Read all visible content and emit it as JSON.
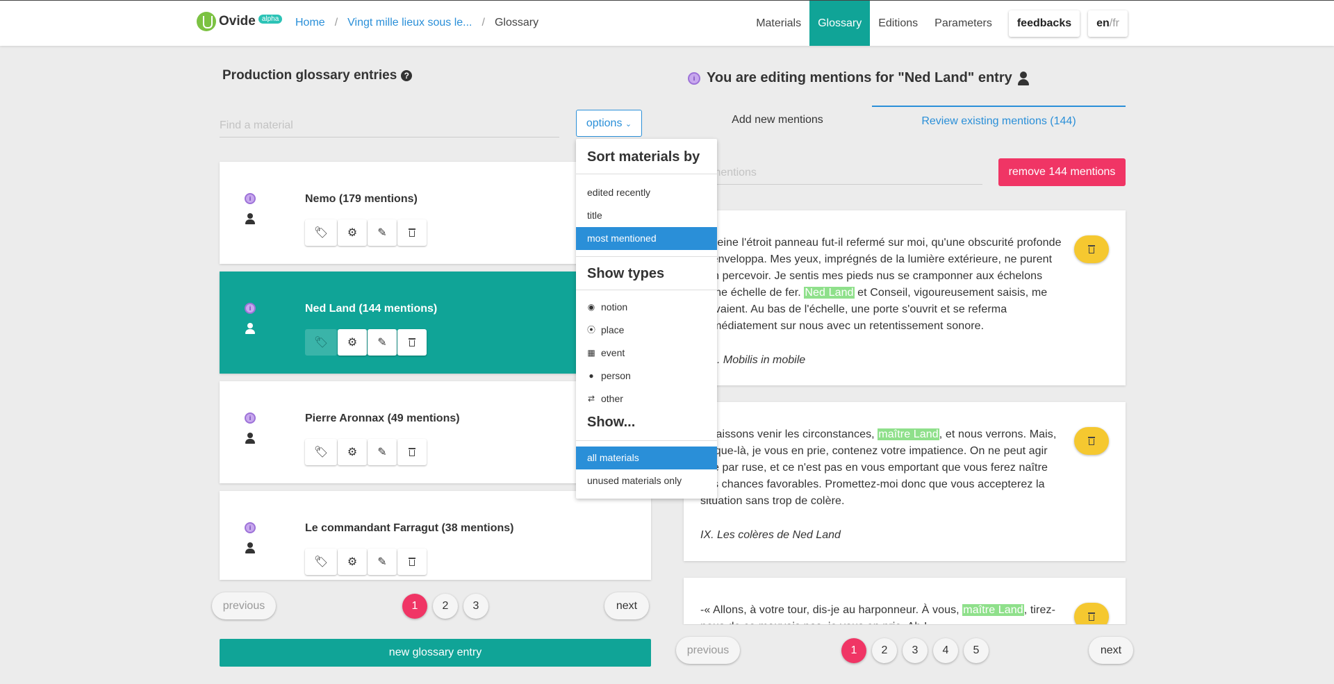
{
  "header": {
    "logo_text": "Ovide",
    "logo_badge": "alpha",
    "breadcrumb": [
      "Home",
      "Vingt mille lieux sous le...",
      "Glossary"
    ],
    "nav": [
      "Materials",
      "Glossary",
      "Editions",
      "Parameters"
    ],
    "active_nav": "Glossary",
    "feedbacks": "feedbacks",
    "lang_en": "en",
    "lang_fr": "/fr"
  },
  "left": {
    "title": "Production glossary entries",
    "search_placeholder": "Find a material",
    "options_label": "options",
    "entries": [
      {
        "name": "Nemo (179 mentions)",
        "selected": false
      },
      {
        "name": "Ned Land (144 mentions)",
        "selected": true
      },
      {
        "name": "Pierre Aronnax (49 mentions)",
        "selected": false
      },
      {
        "name": "Le commandant Farragut (38 mentions)",
        "selected": false
      }
    ],
    "pager": {
      "previous": "previous",
      "next": "next",
      "pages": [
        "1",
        "2",
        "3"
      ],
      "current": "1"
    },
    "new_entry": "new glossary entry"
  },
  "dropdown": {
    "sort_heading": "Sort materials by",
    "sort_options": [
      "edited recently",
      "title",
      "most mentioned"
    ],
    "sort_active": "most mentioned",
    "types_heading": "Show types",
    "types": [
      "notion",
      "place",
      "event",
      "person",
      "other"
    ],
    "show_heading": "Show...",
    "show_options": [
      "all materials",
      "unused materials only"
    ],
    "show_active": "all materials"
  },
  "right": {
    "title": "You are editing mentions for \"Ned Land\" entry",
    "tab_add": "Add new mentions",
    "tab_review": "Review existing mentions (144)",
    "filter_placeholder": "Filter mentions",
    "remove_label": "remove 144 mentions",
    "mentions": [
      {
        "before": "À peine l'étroit panneau fut-il refermé sur moi, qu'une obscurité profonde m'enveloppa. Mes yeux, imprégnés de la lumière extérieure, ne purent rien percevoir. Je sentis mes pieds nus se cramponner aux échelons d'une échelle de fer. ",
        "highlight": "Ned Land",
        "after": " et Conseil, vigoureusement saisis, me suivaient. Au bas de l'échelle, une porte s'ouvrit et se referma immédiatement sur nous avec un retentissement sonore.",
        "source": "VIII. Mobilis in mobile"
      },
      {
        "before": "– Laissons venir les circonstances, ",
        "highlight": "maître Land",
        "after": ", et nous verrons. Mais, jusque-là, je vous en prie, contenez votre impatience. On ne peut agir que par ruse, et ce n'est pas en vous emportant que vous ferez naître des chances favorables. Promettez-moi donc que vous accepterez la situation sans trop de colère.",
        "source": "IX. Les colères de Ned Land"
      },
      {
        "before": "-« Allons, à votre tour, dis-je au harponneur. À vous, ",
        "highlight": "maître Land",
        "after": ", tirez-nous de ce mauvais pas, je vous en prie. Ah !",
        "source": ""
      }
    ],
    "pager": {
      "previous": "previous",
      "next": "next",
      "pages": [
        "1",
        "2",
        "3",
        "4",
        "5"
      ],
      "current": "1"
    }
  },
  "colors": {
    "teal": "#10a497",
    "blue": "#2a8fd8",
    "pink": "#f03565",
    "yellow": "#f5c830",
    "highlight": "#8fe08b"
  }
}
